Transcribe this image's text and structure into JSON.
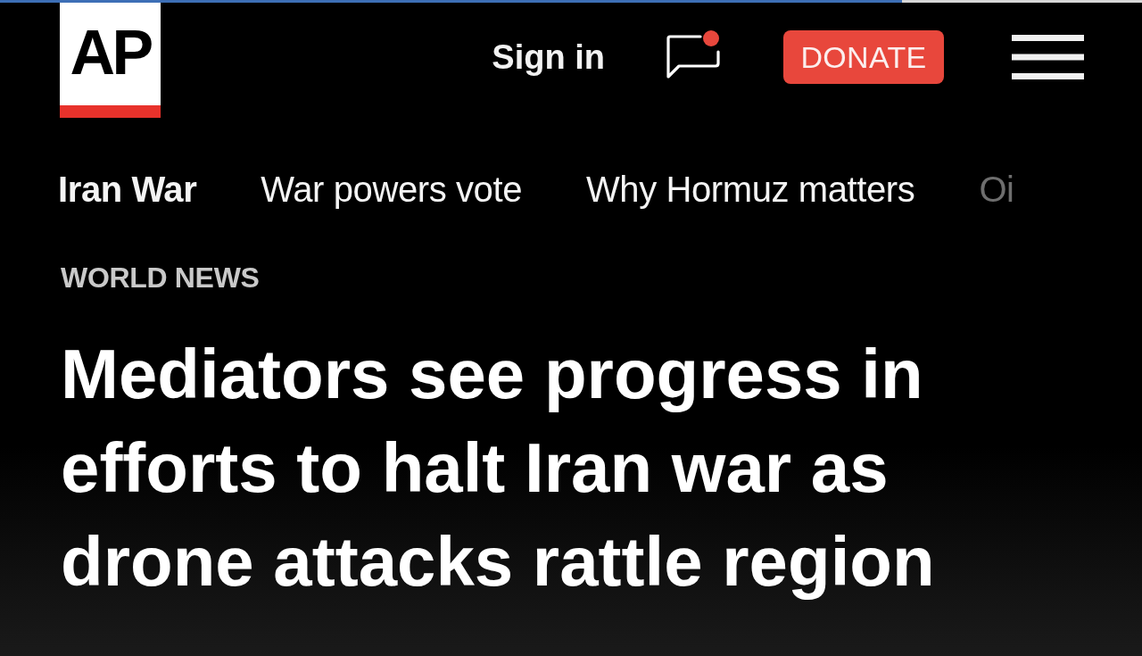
{
  "loading_bar": {
    "level": 0.79
  },
  "header": {
    "logo": "AP",
    "sign_in": "Sign in",
    "messages": {
      "unread": true
    },
    "donate": "DONATE"
  },
  "topics": [
    {
      "label": "Iran War",
      "selected": true,
      "faded": false
    },
    {
      "label": "War powers vote",
      "selected": false,
      "faded": false
    },
    {
      "label": "Why Hormuz matters",
      "selected": false,
      "faded": false
    },
    {
      "label": "Oi",
      "selected": false,
      "faded": true
    }
  ],
  "article": {
    "section": "WORLD NEWS",
    "headline": "Mediators see progress in efforts to halt Iran war as drone attacks rattle region"
  }
}
